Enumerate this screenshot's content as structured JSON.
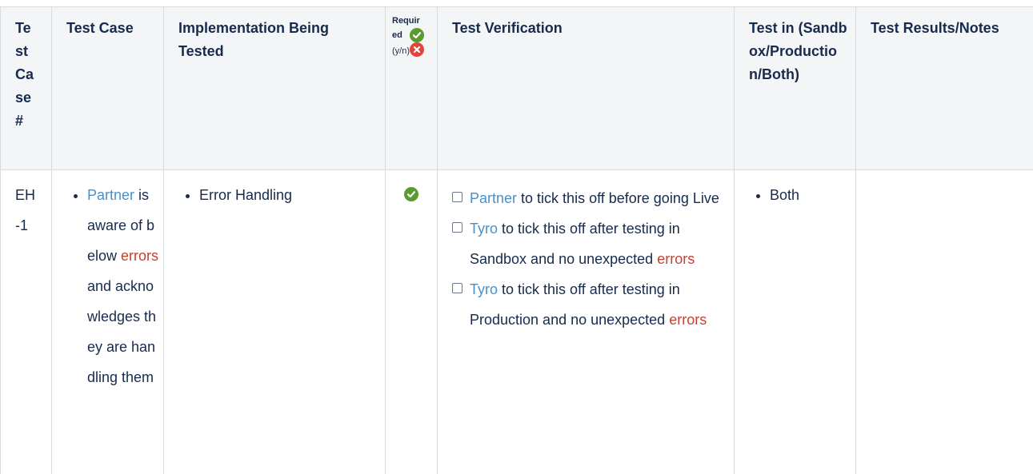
{
  "table": {
    "headers": {
      "test_case_num": "Te st Ca se #",
      "test_case": "Test Case",
      "implementation": "Implementation Being Tested",
      "required_top": "Requir ed",
      "required_bottom": "(y/n)",
      "verification": "Test Verification",
      "test_in": "Test in (Sandbox/Production/Both)",
      "results": "Test Results/Notes"
    },
    "row": {
      "case_id": "EH -1",
      "test_case": {
        "link": "Partner",
        "text_1": "is aware of below",
        "error_word": "errors",
        "text_2": "and acknowledges they are handling them"
      },
      "implementation": "Error Handling",
      "verification": [
        {
          "link": "Partner",
          "text": "to tick this off before going Live",
          "error_word": ""
        },
        {
          "link": "Tyro",
          "text": "to tick this off after testing in Sandbox and no unexpected",
          "error_word": "errors"
        },
        {
          "link": "Tyro",
          "text": "to tick this off after testing in Production and no unexpected",
          "error_word": "errors"
        }
      ],
      "test_in": "Both",
      "results": ""
    }
  },
  "colors": {
    "header_bg": "#f4f5f7",
    "border": "#d9dcde",
    "link": "#4a90c8",
    "error": "#c5412f",
    "check_green": "#5b9a2c",
    "cross_red": "#e0443d"
  },
  "icons": {
    "yes": "green-check-circle-icon",
    "no": "red-cross-circle-icon",
    "checkbox": "checkbox-icon"
  }
}
